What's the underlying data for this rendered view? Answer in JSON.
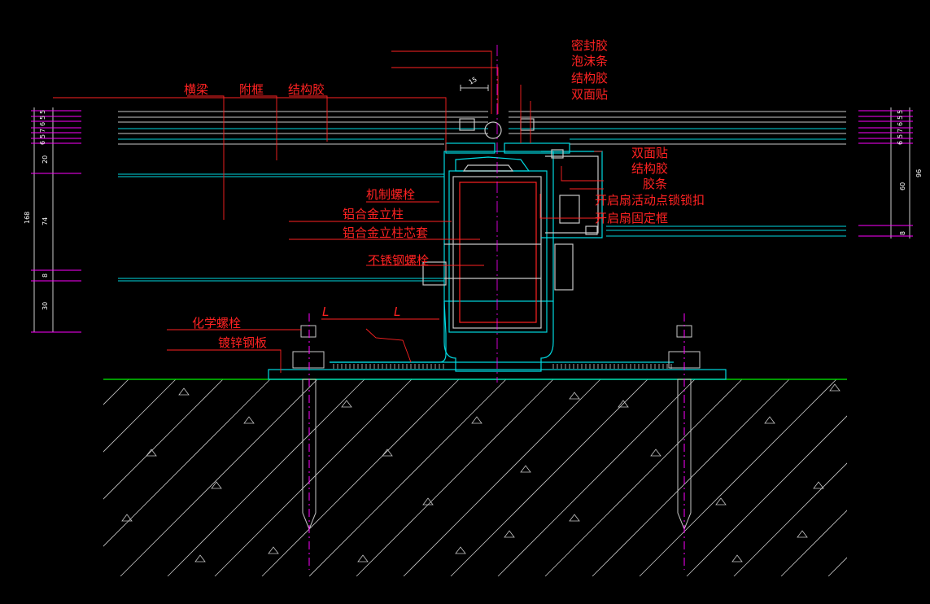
{
  "labels": {
    "sealant": "密封胶",
    "foam_rod": "泡沫条",
    "structural_glue_top": "结构胶",
    "double_tape_top": "双面贴",
    "crossbeam": "横梁",
    "auxiliary_frame": "附框",
    "structural_glue_left": "结构胶",
    "double_tape_right": "双面贴",
    "structural_glue_right": "结构胶",
    "rubber_strip": "胶条",
    "machine_screw": "机制螺栓",
    "aluminum_mullion": "铝合金立柱",
    "mullion_core_sleeve": "铝合金立柱芯套",
    "stainless_bolt": "不锈钢螺栓",
    "vent_multipoint_lock": "开启扇活动点锁锁扣",
    "vent_fixed_frame": "开启扇固定框",
    "chemical_anchor": "化学螺栓",
    "galvanized_plate": "镀锌钢板"
  },
  "dimensions": {
    "left": [
      "5",
      "5",
      "6",
      "7",
      "5",
      "6",
      "20",
      "74",
      "8",
      "30",
      "168"
    ],
    "right": [
      "5",
      "5",
      "6",
      "7",
      "5",
      "6",
      "60",
      "8",
      "96"
    ],
    "top_gap": "15",
    "weld_symbol_1": "L",
    "weld_symbol_2": "L"
  },
  "colors": {
    "background": "#000000",
    "label": "#ff2222",
    "dimension_tick": "#ff00ff",
    "structure": "#00d8e0",
    "ground": "#00cc00",
    "hatch": "#c8c8c8"
  }
}
